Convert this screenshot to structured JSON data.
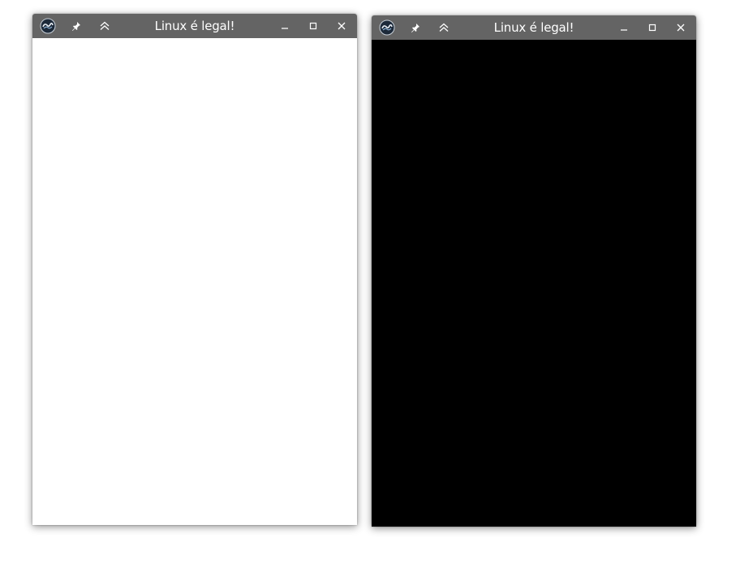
{
  "windows": [
    {
      "title": "Linux é legal!",
      "content_color": "#ffffff",
      "titlebar_color": "#646464",
      "buttons": {
        "menu_icon": "kde-logo-icon",
        "pin_icon": "pin-icon",
        "shade_icon": "shade-chevrons-up-icon",
        "minimize_icon": "minimize-icon",
        "maximize_icon": "maximize-icon",
        "close_icon": "close-icon"
      }
    },
    {
      "title": "Linux é legal!",
      "content_color": "#000000",
      "titlebar_color": "#646464",
      "buttons": {
        "menu_icon": "kde-logo-icon",
        "pin_icon": "pin-icon",
        "shade_icon": "shade-chevrons-up-icon",
        "minimize_icon": "minimize-icon",
        "maximize_icon": "maximize-icon",
        "close_icon": "close-icon"
      }
    }
  ]
}
